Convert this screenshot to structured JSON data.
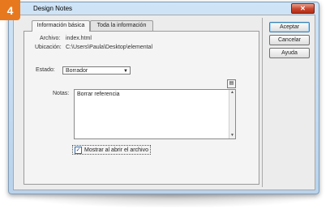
{
  "step_badge": "4",
  "window": {
    "title": "Design Notes",
    "close_glyph": "✕"
  },
  "tabs": [
    {
      "label": "Información básica",
      "active": true
    },
    {
      "label": "Toda la información",
      "active": false
    }
  ],
  "info": {
    "archivo_label": "Archivo:",
    "archivo_value": "index.html",
    "ubicacion_label": "Ubicación:",
    "ubicacion_value": "C:\\Users\\Paula\\Desktop\\elemental",
    "estado_label": "Estado:",
    "estado_value": "Borrador",
    "notas_label": "Notas:",
    "notas_value": "Borrar referencia",
    "date_button_icon": "calendar-icon",
    "checkbox_label": "Mostrar al abrir el archivo",
    "checkbox_checked": true
  },
  "buttons": {
    "accept": "Aceptar",
    "cancel": "Cancelar",
    "help": "Ayuda"
  }
}
